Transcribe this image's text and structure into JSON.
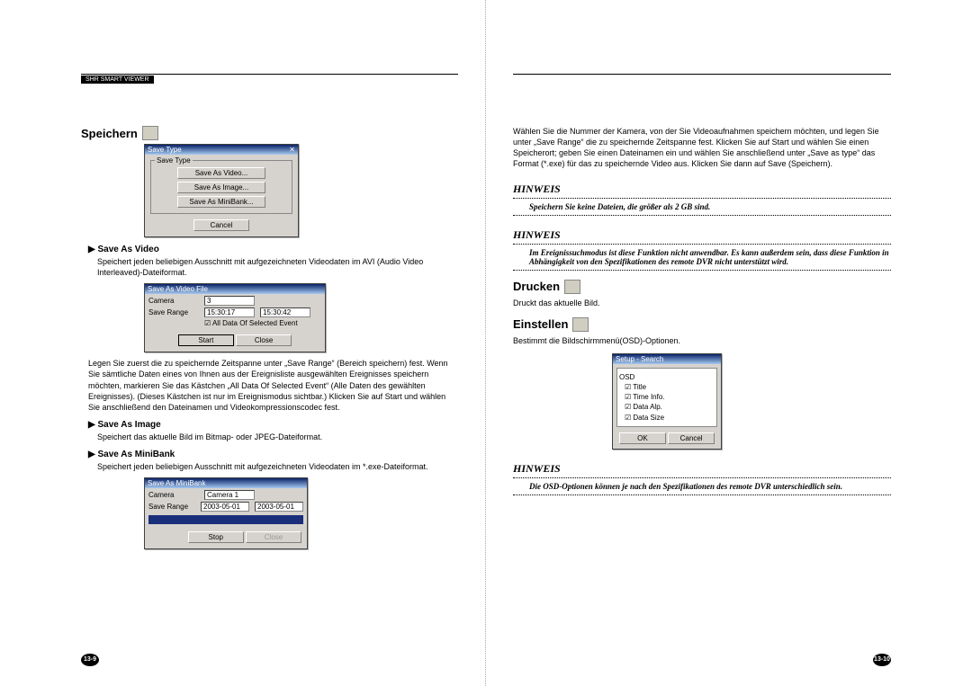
{
  "header": {
    "label": "SHR SMART VIEWER"
  },
  "left": {
    "title": "Speichern",
    "dlg1": {
      "title": "Save Type",
      "group": "Save Type",
      "btn_video": "Save As Video...",
      "btn_image": "Save As Image...",
      "btn_mini": "Save As MiniBank...",
      "cancel": "Cancel"
    },
    "sav_video": {
      "head": "▶ Save As Video",
      "body": "Speichert jeden beliebigen Ausschnitt mit aufgezeichneten Videodaten im AVI (Audio Video Interleaved)-Dateiformat."
    },
    "dlg2": {
      "title": "Save As Video File",
      "camera_lbl": "Camera",
      "camera_val": "3",
      "range_lbl": "Save Range",
      "range_a": "15:30:17",
      "range_b": "15:30:42",
      "chk": "All Data Of Selected Event",
      "start": "Start",
      "close": "Close"
    },
    "para": "Legen Sie zuerst die zu speichernde Zeitspanne unter „Save Range“ (Bereich speichern) fest. Wenn Sie sämtliche Daten eines von Ihnen aus der Ereignisliste ausgewählten Ereignisses speichern möchten, markieren Sie das Kästchen „All Data Of Selected Event“ (Alle Daten des gewählten Ereignisses). (Dieses Kästchen ist nur im Ereignismodus sichtbar.) Klicken Sie auf Start und wählen Sie anschließend den Dateinamen und Videokompressionscodec fest.",
    "sav_image": {
      "head": "▶ Save As Image",
      "body": "Speichert das aktuelle Bild im Bitmap- oder JPEG-Dateiformat."
    },
    "sav_mini": {
      "head": "▶ Save As MiniBank",
      "body": "Speichert jeden beliebigen Ausschnitt mit aufgezeichneten Videodaten im *.exe-Dateiformat."
    },
    "dlg3": {
      "title": "Save As MiniBank",
      "camera_lbl": "Camera",
      "camera_val": "Camera 1",
      "range_lbl": "Save Range",
      "range_a": "2003-05-01",
      "range_b": "2003-05-01",
      "stop": "Stop",
      "close": "Close"
    },
    "pagenum": "13-9"
  },
  "right": {
    "intro": "Wählen Sie die Nummer der Kamera, von der Sie Videoaufnahmen speichern möchten, und legen Sie unter „Save Range“ die zu speichernde Zeitspanne fest. Klicken Sie auf Start und wählen Sie einen Speicherort; geben Sie einen Dateinamen ein und wählen Sie anschließend unter „Save as type“ das Format (*.exe) für das zu speichernde Video aus. Klicken Sie dann auf Save (Speichern).",
    "hinweis1": {
      "title": "HINWEIS",
      "body": "Speichern Sie keine Dateien, die größer als 2 GB sind."
    },
    "hinweis2": {
      "title": "HINWEIS",
      "body": "Im Ereignissuchmodus ist diese Funktion nicht anwendbar. Es kann außerdem sein, dass diese Funktion in Abhängigkeit von den Spezifikationen des remote DVR nicht unterstützt wird."
    },
    "drucken": {
      "title": "Drucken",
      "body": "Druckt das aktuelle Bild."
    },
    "einstellen": {
      "title": "Einstellen",
      "body": "Bestimmt die Bildschirmmenü(OSD)-Optionen."
    },
    "dlg_setup": {
      "title": "Setup - Search",
      "group": "OSD",
      "opt1": "Title",
      "opt2": "Time Info.",
      "opt3": "Data Alp.",
      "opt4": "Data Size",
      "ok": "OK",
      "cancel": "Cancel"
    },
    "hinweis3": {
      "title": "HINWEIS",
      "body": "Die OSD-Optionen können je nach den Spezifikationen des remote DVR unterschiedlich sein."
    },
    "pagenum": "13-10"
  }
}
